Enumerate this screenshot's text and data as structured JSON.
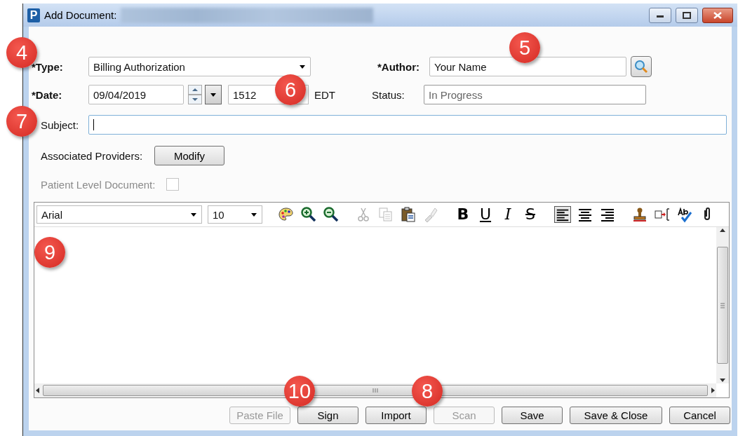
{
  "window": {
    "app_letter": "P",
    "title": "Add Document:"
  },
  "form": {
    "type": {
      "label": "*Type:",
      "value": "Billing Authorization"
    },
    "author": {
      "label": "*Author:",
      "value": "Your Name"
    },
    "date": {
      "label": "*Date:",
      "value": "09/04/2019",
      "time": "1512",
      "timezone": "EDT"
    },
    "status": {
      "label": "Status:",
      "value": "In Progress"
    },
    "subject": {
      "label": "Subject:"
    },
    "associated_providers": {
      "label": "Associated Providers:",
      "button": "Modify"
    },
    "patient_level_document": {
      "label": "Patient Level Document:",
      "checked": false,
      "disabled": true
    }
  },
  "editor": {
    "font": "Arial",
    "size": "10",
    "toolbar": [
      {
        "kind": "palette",
        "disabled": false
      },
      {
        "kind": "zoom-in",
        "disabled": false
      },
      {
        "kind": "zoom-out",
        "disabled": false
      },
      {
        "kind": "cut",
        "disabled": true
      },
      {
        "kind": "copy",
        "disabled": true
      },
      {
        "kind": "paste",
        "disabled": false
      },
      {
        "kind": "brush",
        "disabled": true
      },
      {
        "kind": "bold",
        "text": "B",
        "disabled": false
      },
      {
        "kind": "underline",
        "text": "U",
        "disabled": false
      },
      {
        "kind": "italic",
        "text": "I",
        "disabled": false
      },
      {
        "kind": "strike",
        "text": "S",
        "disabled": false
      },
      {
        "kind": "align-left",
        "selected": true,
        "disabled": false
      },
      {
        "kind": "align-center",
        "selected": false,
        "disabled": false
      },
      {
        "kind": "align-right",
        "selected": false,
        "disabled": false
      },
      {
        "kind": "stamp",
        "disabled": false
      },
      {
        "kind": "insert",
        "disabled": false
      },
      {
        "kind": "spell",
        "disabled": false
      },
      {
        "kind": "attach",
        "disabled": false
      }
    ]
  },
  "buttons": [
    {
      "label": "Paste File",
      "disabled": true
    },
    {
      "label": "Sign",
      "disabled": false
    },
    {
      "label": "Import",
      "disabled": false
    },
    {
      "label": "Scan",
      "disabled": true
    },
    {
      "label": "Save",
      "disabled": false
    },
    {
      "label": "Save & Close",
      "disabled": false
    },
    {
      "label": "Cancel",
      "disabled": false
    }
  ],
  "callouts": [
    {
      "text": "4"
    },
    {
      "text": "5"
    },
    {
      "text": "6"
    },
    {
      "text": "7"
    },
    {
      "text": "9"
    },
    {
      "text": "10"
    },
    {
      "text": "8"
    }
  ]
}
